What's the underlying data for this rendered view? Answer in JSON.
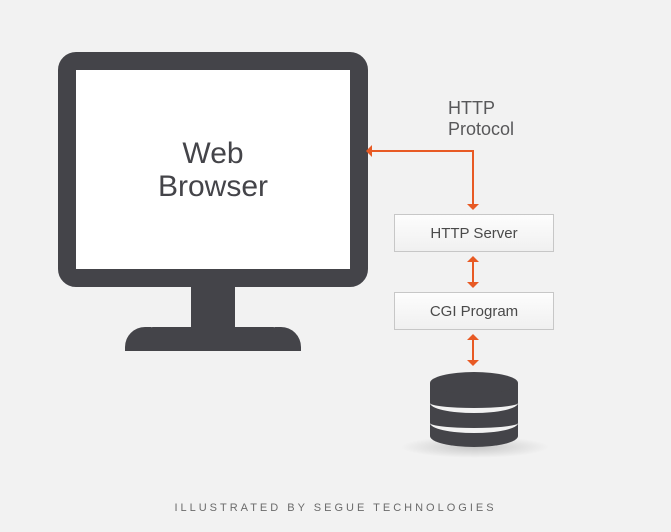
{
  "browser": {
    "line1": "Web",
    "line2": "Browser"
  },
  "protocol_label": {
    "line1": "HTTP",
    "line2": "Protocol"
  },
  "boxes": {
    "http_server": "HTTP Server",
    "cgi_program": "CGI Program"
  },
  "attribution": "ILLUSTRATED BY SEGUE TECHNOLOGIES",
  "colors": {
    "accent": "#e85a24",
    "shape": "#444449"
  },
  "diagram": {
    "nodes": [
      "Web Browser",
      "HTTP Server",
      "CGI Program",
      "Database"
    ],
    "edges": [
      {
        "from": "Web Browser",
        "to": "HTTP Server",
        "label": "HTTP Protocol",
        "bidirectional": true
      },
      {
        "from": "HTTP Server",
        "to": "CGI Program",
        "bidirectional": true
      },
      {
        "from": "CGI Program",
        "to": "Database",
        "bidirectional": true
      }
    ]
  }
}
